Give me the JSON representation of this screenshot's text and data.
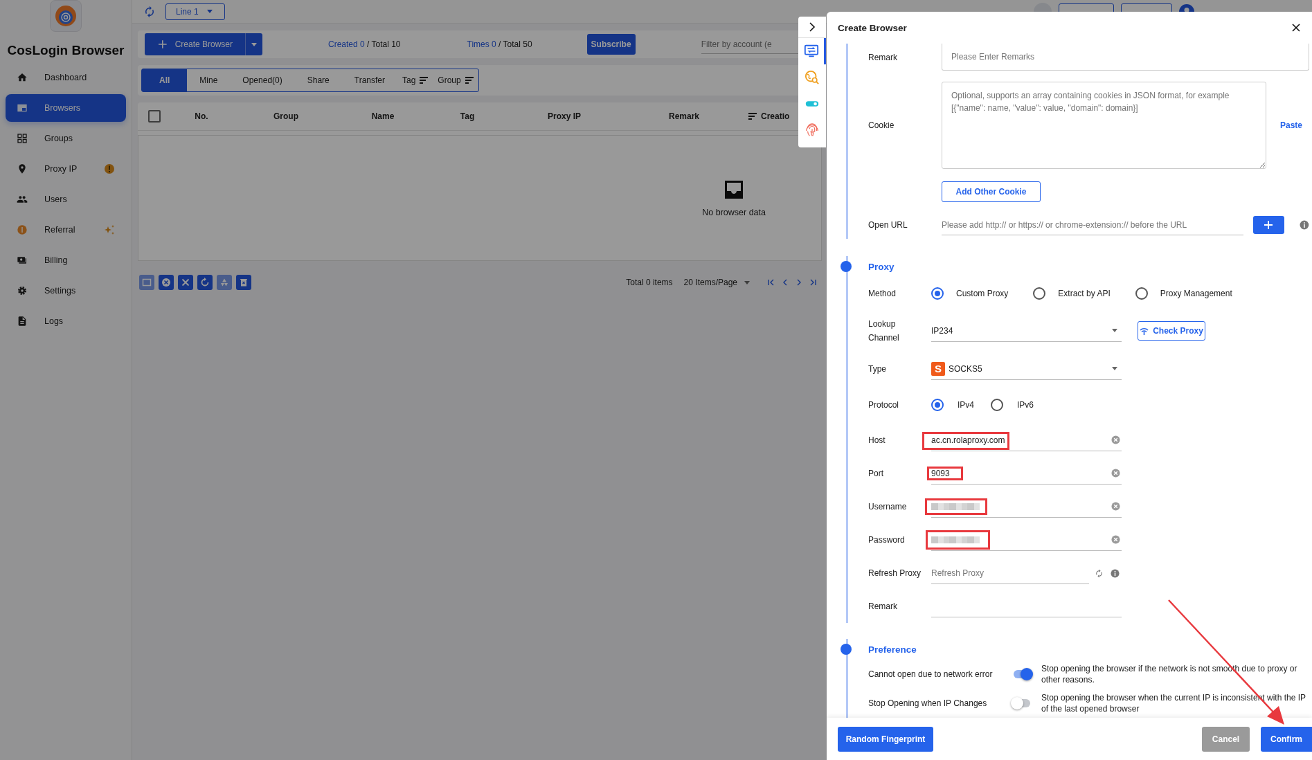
{
  "sidebar": {
    "title": "CosLogin Browser",
    "items": [
      {
        "label": "Dashboard",
        "selected": false
      },
      {
        "label": "Browsers",
        "selected": true
      },
      {
        "label": "Groups",
        "selected": false
      },
      {
        "label": "Proxy IP",
        "selected": false
      },
      {
        "label": "Users",
        "selected": false
      },
      {
        "label": "Referral",
        "selected": false
      },
      {
        "label": "Billing",
        "selected": false
      },
      {
        "label": "Settings",
        "selected": false
      },
      {
        "label": "Logs",
        "selected": false
      }
    ]
  },
  "topbar": {
    "line": "Line 1"
  },
  "toolbar": {
    "create": "Create Browser",
    "created": "Created 0",
    "created_total": " / Total 10",
    "times": "Times 0",
    "times_total": " / Total 50",
    "subscribe": "Subscribe",
    "filter_placeholder": "Filter by account (e"
  },
  "filter_tabs": [
    {
      "label": "All",
      "selected": true,
      "sortable": false
    },
    {
      "label": "Mine",
      "selected": false,
      "sortable": false
    },
    {
      "label": "Opened(0)",
      "selected": false,
      "sortable": false
    },
    {
      "label": "Share",
      "selected": false,
      "sortable": false
    },
    {
      "label": "Transfer",
      "selected": false,
      "sortable": false
    },
    {
      "label": "Tag",
      "selected": false,
      "sortable": true
    },
    {
      "label": "Group",
      "selected": false,
      "sortable": true
    }
  ],
  "table": {
    "columns": [
      {
        "label": "No.",
        "sortable": false
      },
      {
        "label": "Group",
        "sortable": false
      },
      {
        "label": "Name",
        "sortable": false
      },
      {
        "label": "Tag",
        "sortable": false
      },
      {
        "label": "Proxy IP",
        "sortable": false
      },
      {
        "label": "Remark",
        "sortable": false
      },
      {
        "label": "Creatio",
        "sortable": true
      }
    ],
    "select_all_checked": false,
    "empty_text": "No browser data"
  },
  "bulk_actions": [
    {
      "kind": "window",
      "disabled": true
    },
    {
      "kind": "cancel",
      "disabled": false
    },
    {
      "kind": "close",
      "disabled": false
    },
    {
      "kind": "restart",
      "disabled": false
    },
    {
      "kind": "recycle",
      "disabled": true
    },
    {
      "kind": "delete",
      "disabled": false
    }
  ],
  "pagination": {
    "total": "Total 0 items",
    "page_size": "20 Items/Page"
  },
  "side_tools": [
    {
      "kind": "monitor",
      "selected": true
    },
    {
      "kind": "globe",
      "selected": false
    },
    {
      "kind": "toggle",
      "selected": false
    },
    {
      "kind": "fingerprint",
      "selected": false
    }
  ],
  "drawer": {
    "title": "Create Browser",
    "remark": {
      "label": "Remark",
      "placeholder": "Please Enter Remarks"
    },
    "cookie": {
      "label": "Cookie",
      "placeholder": "Optional, supports an array containing cookies in JSON format, for example\n[{\"name\": name, \"value\": value, \"domain\": domain}]",
      "paste": "Paste",
      "add": "Add Other Cookie"
    },
    "open_url": {
      "label": "Open URL",
      "placeholder": "Please add http:// or https:// or chrome-extension:// before the URL"
    },
    "proxy": {
      "heading": "Proxy",
      "method": {
        "label": "Method",
        "options": [
          {
            "label": "Custom Proxy",
            "selected": true
          },
          {
            "label": "Extract by API",
            "selected": false
          },
          {
            "label": "Proxy Management",
            "selected": false
          }
        ]
      },
      "lookup": {
        "label": "Lookup Channel",
        "value": "IP234",
        "check": "Check Proxy"
      },
      "type": {
        "label": "Type",
        "badge": "S",
        "value": "SOCKS5"
      },
      "protocol": {
        "label": "Protocol",
        "options": [
          {
            "label": "IPv4",
            "selected": true
          },
          {
            "label": "IPv6",
            "selected": false
          }
        ]
      },
      "fields": [
        {
          "kind": "text",
          "label": "Host",
          "value": "ac.cn.rolaproxy.com",
          "highlighted": true
        },
        {
          "kind": "text",
          "label": "Port",
          "value": "9093",
          "highlighted": true
        },
        {
          "kind": "redacted",
          "label": "Username",
          "highlighted": true
        },
        {
          "kind": "redacted",
          "label": "Password",
          "highlighted": true
        },
        {
          "kind": "refresh",
          "label": "Refresh Proxy",
          "placeholder": "Refresh Proxy"
        },
        {
          "kind": "plain",
          "label": "Remark"
        }
      ]
    },
    "preference": {
      "heading": "Preference",
      "rows": [
        {
          "label": "Cannot open due to network error",
          "on": true,
          "description": "Stop opening the browser if the network is not smooth due to proxy or other reasons."
        },
        {
          "label": "Stop Opening when IP Changes",
          "on": false,
          "description": "Stop opening the browser when the current IP is inconsistent with the IP of the last opened browser"
        }
      ]
    },
    "footer": {
      "random": "Random Fingerprint",
      "cancel": "Cancel",
      "confirm": "Confirm"
    }
  }
}
